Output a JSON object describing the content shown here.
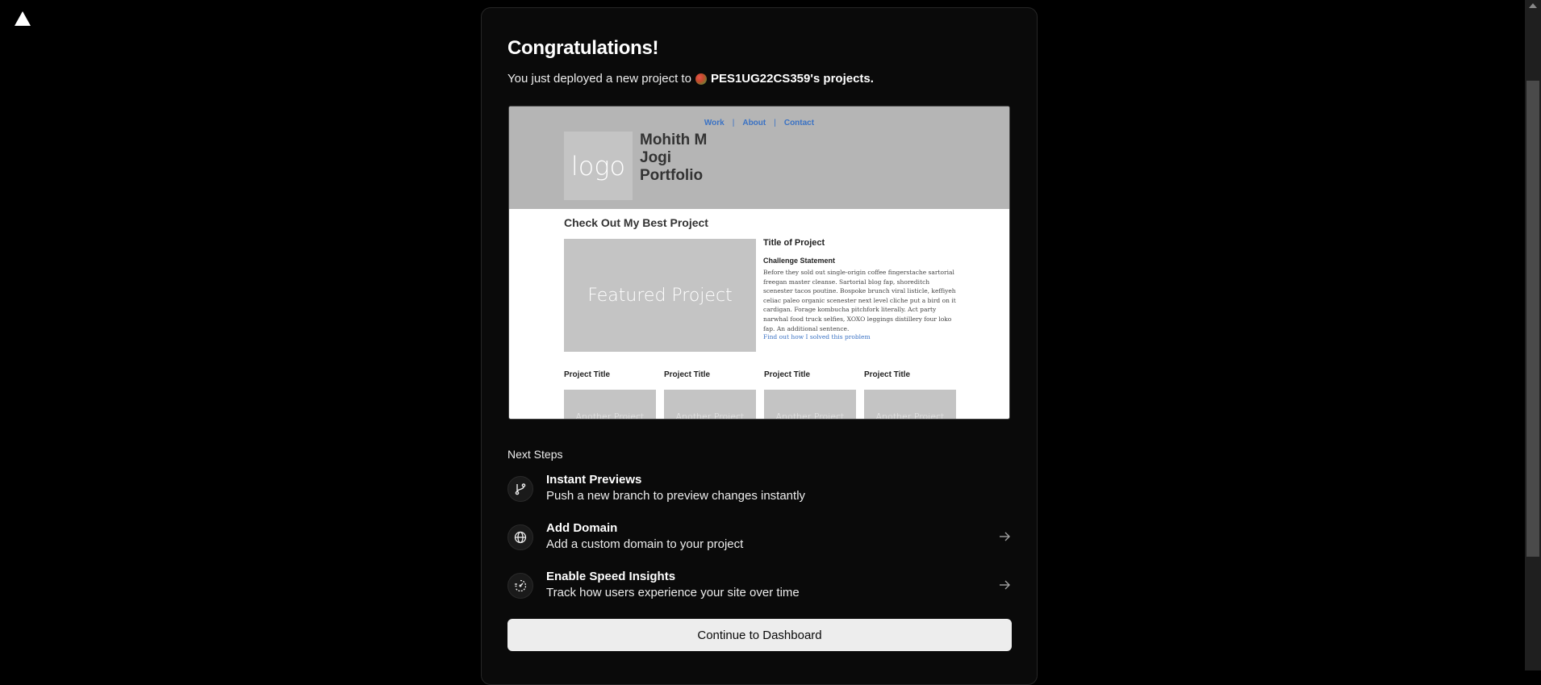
{
  "card": {
    "title": "Congratulations!",
    "subtitle_prefix": "You just deployed a new project to",
    "team_name": "PES1UG22CS359's projects."
  },
  "preview": {
    "nav": [
      "Work",
      "About",
      "Contact"
    ],
    "logo_text": "logo",
    "name": "Mohith M Jogi Portfolio",
    "section_title": "Check Out My Best Project",
    "featured_label": "Featured Project",
    "project_title": "Title of Project",
    "challenge_label": "Challenge Statement",
    "body_text": "Before they sold out single-origin coffee fingerstache sartorial freegan master cleanse. Sartorial blog fap, shoreditch scenester tacos poutine. Bospoke brunch viral listicle, keffiyeh celiac paleo organic scenester next level cliche put a bird on it cardigan. Forage kombucha pitchfork literally. Act party narwhal food truck selfies, XOXO leggings distillery four loko fap. An additional sentence.",
    "link_text": "Find out how I solved this problem",
    "grid_titles": [
      "Project Title",
      "Project Title",
      "Project Title",
      "Project Title"
    ],
    "grid_box_label": "Another Project"
  },
  "next_steps": {
    "heading": "Next Steps",
    "items": [
      {
        "title": "Instant Previews",
        "desc": "Push a new branch to preview changes instantly",
        "icon": "git-branch-icon"
      },
      {
        "title": "Add Domain",
        "desc": "Add a custom domain to your project",
        "icon": "globe-icon"
      },
      {
        "title": "Enable Speed Insights",
        "desc": "Track how users experience your site over time",
        "icon": "speed-gauge-icon"
      }
    ]
  },
  "continue_label": "Continue to Dashboard"
}
